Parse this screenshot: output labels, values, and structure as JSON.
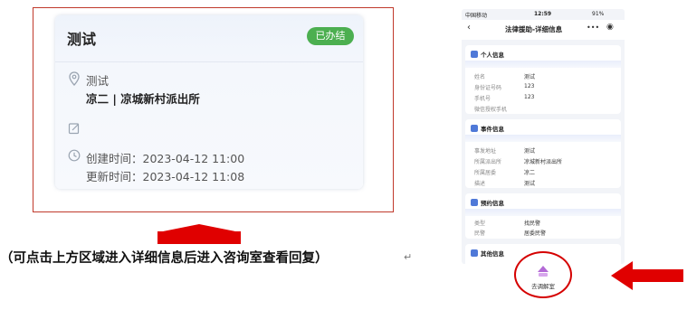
{
  "card": {
    "title": "测试",
    "status": "已办结",
    "item_name": "测试",
    "location": "凉二 | 凉城新村派出所",
    "created": "创建时间：2023-04-12 11:00",
    "updated": "更新时间：2023-04-12 11:08"
  },
  "caption": "（可点击上方区域进入详细信息后进入咨询室查看回复）",
  "caption_mark": "↵",
  "phone": {
    "carrier": "中国移动",
    "time": "12:59",
    "battery": "91%",
    "nav_title": "法律援助-详细信息",
    "sections": [
      {
        "title": "个人信息",
        "rows": [
          [
            "姓名",
            "测试"
          ],
          [
            "身份证号码",
            "123"
          ],
          [
            "手机号",
            "123"
          ],
          [
            "微信授权手机",
            ""
          ]
        ]
      },
      {
        "title": "事件信息",
        "rows": [
          [
            "事发地址",
            "测试"
          ],
          [
            "所属派出所",
            "凉城新村派出所"
          ],
          [
            "所属居委",
            "凉二"
          ],
          [
            "描述",
            "测试"
          ]
        ]
      },
      {
        "title": "预约信息",
        "rows": [
          [
            "类型",
            "找民警"
          ],
          [
            "民警",
            "居委民警"
          ]
        ]
      },
      {
        "title": "其他信息",
        "rows": []
      }
    ],
    "consult_label": "去调解室"
  },
  "colors": {
    "badge": "#4caf50",
    "highlight": "#d50000",
    "accent": "#4f79d8"
  }
}
